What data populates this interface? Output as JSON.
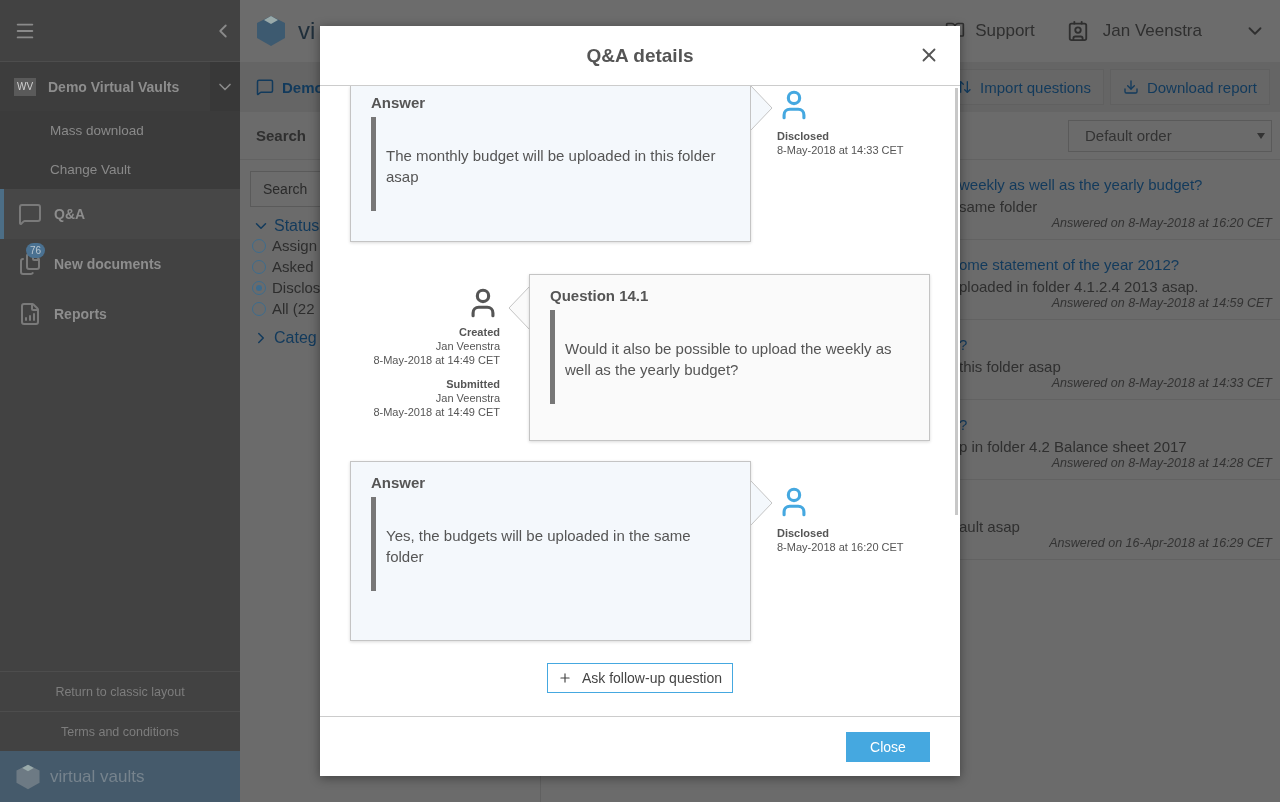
{
  "sidebar": {
    "vault": {
      "label": "Demo Virtual Vaults",
      "logo": "WV",
      "expanded": true,
      "submenu": [
        "Mass download",
        "Change Vault"
      ]
    },
    "nav": [
      {
        "label": "Q&A",
        "selected": true
      },
      {
        "label": "New documents",
        "selected": false,
        "badge": "76"
      },
      {
        "label": "Reports",
        "selected": false
      }
    ],
    "footer_links": [
      "Return to classic layout",
      "Terms and conditions"
    ],
    "brand": "virtual vaults"
  },
  "topbar": {
    "brand": "vi",
    "support": "Support",
    "user": "Jan Veenstra"
  },
  "toolbar": {
    "tab": "Demo",
    "buttons": [
      "Import questions",
      "Download report"
    ]
  },
  "filters": {
    "heading": "Search",
    "search": {
      "placeholder": "Search"
    },
    "sections": [
      {
        "label": "Status",
        "expanded": true,
        "options": [
          {
            "label": "Assign",
            "selected": false
          },
          {
            "label": "Asked",
            "selected": false
          },
          {
            "label": "Disclos",
            "selected": true
          },
          {
            "label": "All (22",
            "selected": false
          }
        ]
      },
      {
        "label": "Categ",
        "expanded": false
      }
    ]
  },
  "list": {
    "sort": "Default order",
    "items": [
      {
        "title": "weekly as well as the yearly budget?",
        "answer": "same folder",
        "date": "Answered on 8-May-2018 at 16:20 CET"
      },
      {
        "title": "ome statement of the year 2012?",
        "answer": "ploaded in folder 4.1.2.4 2013 asap.",
        "date": "Answered on 8-May-2018 at 14:59 CET"
      },
      {
        "title": "?",
        "answer": "this folder asap",
        "date": "Answered on 8-May-2018 at 14:33 CET"
      },
      {
        "title": "?",
        "answer": "p in folder 4.2 Balance sheet 2017",
        "date": "Answered on 8-May-2018 at 14:28 CET"
      },
      {
        "answer": "ault asap",
        "date": "Answered on 16-Apr-2018 at 16:29 CET"
      }
    ]
  },
  "dialog": {
    "title": "Q&A details",
    "thread": [
      {
        "kind": "answer",
        "label": "Answer",
        "text": "The monthly budget will be uploaded in this folder asap",
        "status": "Disclosed",
        "date": "8-May-2018 at 14:33 CET",
        "clipped": true
      },
      {
        "kind": "question",
        "label": "Question 14.1",
        "text": "Would it also be possible to upload the weekly as well as the yearly budget?",
        "events": [
          {
            "label": "Created",
            "name": "Jan Veenstra",
            "date": "8-May-2018 at 14:49 CET"
          },
          {
            "label": "Submitted",
            "name": "Jan Veenstra",
            "date": "8-May-2018 at 14:49 CET"
          }
        ]
      },
      {
        "kind": "answer",
        "label": "Answer",
        "text": "Yes, the budgets will be uploaded in the same folder",
        "status": "Disclosed",
        "date": "8-May-2018 at 16:20 CET",
        "clipped": false
      }
    ],
    "follow_up": "Ask follow-up question",
    "close": "Close"
  }
}
